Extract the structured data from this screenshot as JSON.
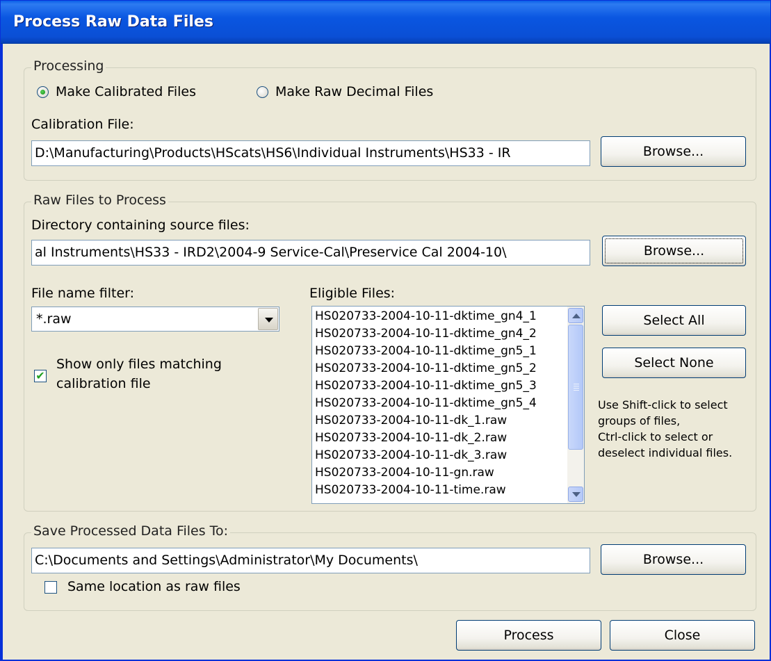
{
  "window": {
    "title": "Process Raw Data Files"
  },
  "processing": {
    "legend": "Processing",
    "radio_calibrated": "Make Calibrated Files",
    "radio_raw": "Make Raw Decimal Files",
    "selected": "calibrated",
    "calibration_label": "Calibration File:",
    "calibration_value": "D:\\Manufacturing\\Products\\HScats\\HS6\\Individual Instruments\\HS33 - IR",
    "browse": "Browse..."
  },
  "raw_files": {
    "legend": "Raw Files to Process",
    "directory_label": "Directory containing source files:",
    "directory_value": "al Instruments\\HS33 - IRD2\\2004-9 Service-Cal\\Preservice Cal 2004-10\\",
    "browse": "Browse...",
    "filter_label": "File name filter:",
    "filter_value": "*.raw",
    "show_matching_line1": "Show only files matching",
    "show_matching_line2": "calibration file",
    "show_matching_checked": true,
    "eligible_label": "Eligible Files:",
    "files": [
      "HS020733-2004-10-11-dktime_gn4_1",
      "HS020733-2004-10-11-dktime_gn4_2",
      "HS020733-2004-10-11-dktime_gn5_1",
      "HS020733-2004-10-11-dktime_gn5_2",
      "HS020733-2004-10-11-dktime_gn5_3",
      "HS020733-2004-10-11-dktime_gn5_4",
      "HS020733-2004-10-11-dk_1.raw",
      "HS020733-2004-10-11-dk_2.raw",
      "HS020733-2004-10-11-dk_3.raw",
      "HS020733-2004-10-11-gn.raw",
      "HS020733-2004-10-11-time.raw"
    ],
    "select_all": "Select All",
    "select_none": "Select None",
    "hint_lines": [
      "Use Shift-click to select",
      "groups of files,",
      "Ctrl-click to select or",
      "deselect individual files."
    ]
  },
  "save": {
    "legend": "Save Processed Data Files To:",
    "path_value": "C:\\Documents and Settings\\Administrator\\My Documents\\",
    "browse": "Browse...",
    "same_location": "Same location as raw files",
    "same_location_checked": false
  },
  "footer": {
    "process": "Process",
    "close": "Close"
  }
}
